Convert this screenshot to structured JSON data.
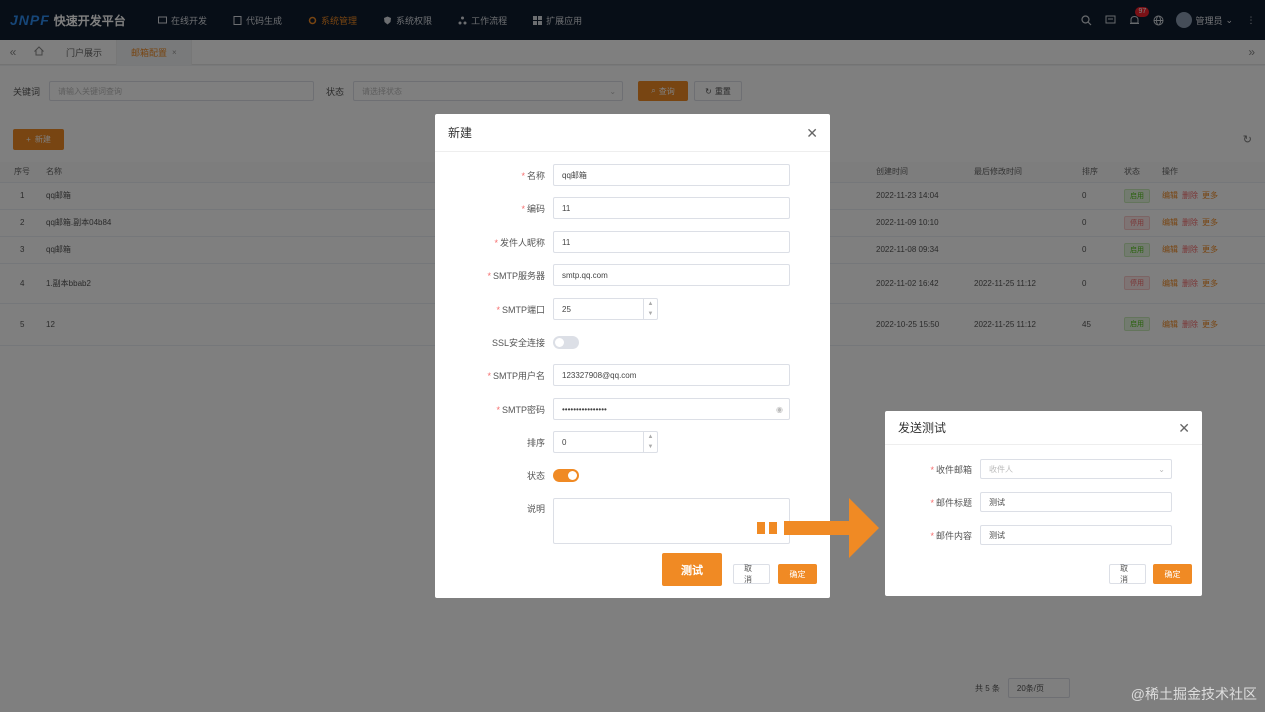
{
  "app": {
    "logo_mark": "JNPF",
    "logo_text": "快速开发平台"
  },
  "nav": [
    {
      "label": "在线开发",
      "icon": "monitor-icon"
    },
    {
      "label": "代码生成",
      "icon": "code-icon"
    },
    {
      "label": "系统管理",
      "icon": "gear-icon"
    },
    {
      "label": "系统权限",
      "icon": "shield-icon"
    },
    {
      "label": "工作流程",
      "icon": "workflow-icon"
    },
    {
      "label": "扩展应用",
      "icon": "grid-icon"
    }
  ],
  "top": {
    "badge": "97",
    "user": "管理员"
  },
  "tabs": {
    "home": "门户展示",
    "active": "邮箱配置"
  },
  "search": {
    "keyword_label": "关键词",
    "keyword_placeholder": "请输入关键词查询",
    "status_label": "状态",
    "status_placeholder": "请选择状态",
    "search_btn": "查询",
    "reset_btn": "重置"
  },
  "toolbar": {
    "add": "新建"
  },
  "table": {
    "headers": [
      "序号",
      "名称",
      "创建时间",
      "最后修改时间",
      "排序",
      "状态",
      "操作"
    ],
    "rows": [
      {
        "idx": "1",
        "name": "qq邮箱",
        "created": "2022-11-23 14:04",
        "modified": "",
        "sort": "0",
        "status": "启用",
        "on": true
      },
      {
        "idx": "2",
        "name": "qq邮箱.副本04b84",
        "created": "2022-11-09 10:10",
        "modified": "",
        "sort": "0",
        "status": "停用",
        "on": false
      },
      {
        "idx": "3",
        "name": "qq邮箱",
        "created": "2022-11-08 09:34",
        "modified": "",
        "sort": "0",
        "status": "启用",
        "on": true
      },
      {
        "idx": "4",
        "name": "1.副本bbab2",
        "created": "2022-11-02 16:42",
        "modified": "2022-11-25 11:12",
        "sort": "0",
        "status": "停用",
        "on": false
      },
      {
        "idx": "5",
        "name": "12",
        "created": "2022-10-25 15:50",
        "modified": "2022-11-25 11:12",
        "sort": "45",
        "status": "启用",
        "on": true
      }
    ],
    "ops": {
      "edit": "编辑",
      "delete": "删除",
      "more": "更多"
    }
  },
  "pager": {
    "total": "共 5 条",
    "size": "20条/页"
  },
  "modal1": {
    "title": "新建",
    "fields": {
      "name_label": "名称",
      "name_value": "qq邮箱",
      "code_label": "编码",
      "code_value": "11",
      "sender_label": "发件人昵称",
      "sender_value": "11",
      "smtp_server_label": "SMTP服务器",
      "smtp_server_value": "smtp.qq.com",
      "smtp_port_label": "SMTP端口",
      "smtp_port_value": "25",
      "ssl_label": "SSL安全连接",
      "smtp_user_label": "SMTP用户名",
      "smtp_user_value": "123327908@qq.com",
      "smtp_pwd_label": "SMTP密码",
      "smtp_pwd_value": "••••••••••••••••",
      "sort_label": "排序",
      "sort_value": "0",
      "status_label": "状态",
      "desc_label": "说明"
    },
    "test_btn": "测试",
    "cancel_btn": "取消",
    "ok_btn": "确定"
  },
  "modal2": {
    "title": "发送测试",
    "recipient_label": "收件邮箱",
    "recipient_placeholder": "收件人",
    "subject_label": "邮件标题",
    "subject_value": "测试",
    "content_label": "邮件内容",
    "content_value": "测试",
    "cancel_btn": "取消",
    "ok_btn": "确定"
  },
  "watermark": "@稀土掘金技术社区",
  "colors": {
    "accent": "#f08a24",
    "topbar": "#0f1c2e"
  }
}
